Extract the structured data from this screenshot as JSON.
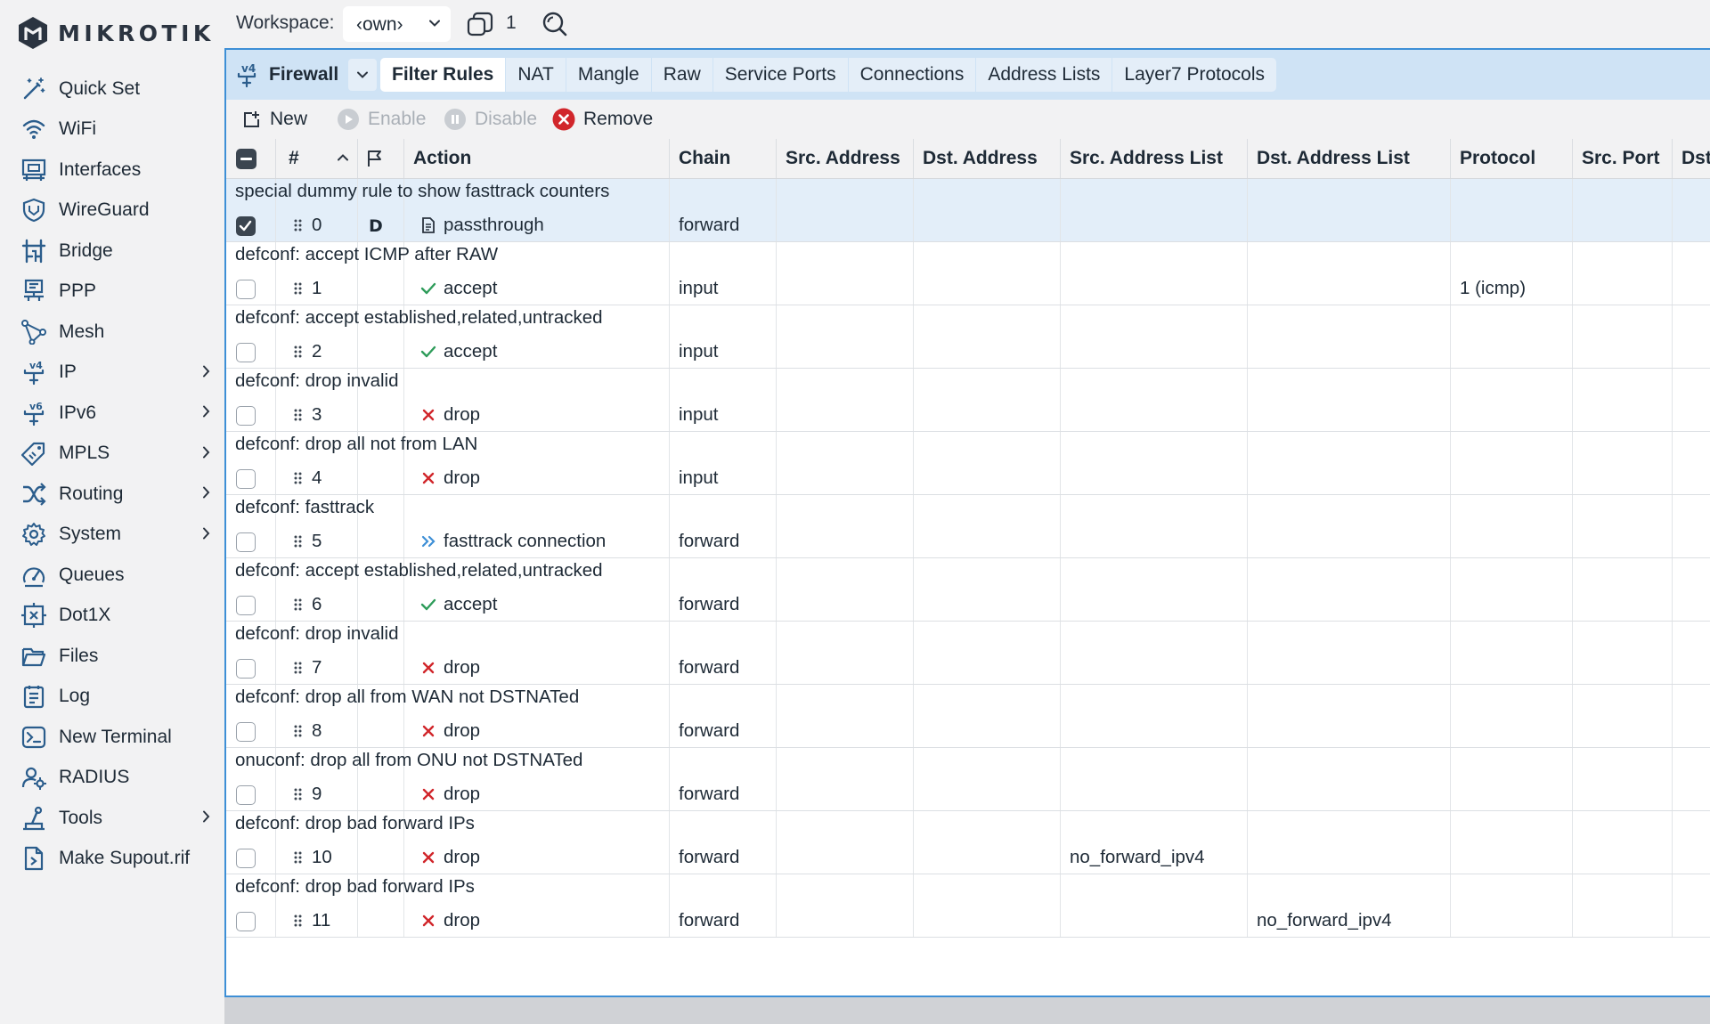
{
  "brand": {
    "name": "MIKROTIK"
  },
  "sidebar": {
    "items": [
      {
        "label": "Quick Set",
        "icon": "wand-icon",
        "has_submenu": false
      },
      {
        "label": "WiFi",
        "icon": "wifi-icon",
        "has_submenu": false
      },
      {
        "label": "Interfaces",
        "icon": "interfaces-icon",
        "has_submenu": false
      },
      {
        "label": "WireGuard",
        "icon": "shield-icon",
        "has_submenu": false
      },
      {
        "label": "Bridge",
        "icon": "bridge-icon",
        "has_submenu": false
      },
      {
        "label": "PPP",
        "icon": "ppp-icon",
        "has_submenu": false
      },
      {
        "label": "Mesh",
        "icon": "mesh-icon",
        "has_submenu": false
      },
      {
        "label": "IP",
        "icon": "ipv4-icon",
        "has_submenu": true
      },
      {
        "label": "IPv6",
        "icon": "ipv6-icon",
        "has_submenu": true
      },
      {
        "label": "MPLS",
        "icon": "tag-icon",
        "has_submenu": true
      },
      {
        "label": "Routing",
        "icon": "routing-icon",
        "has_submenu": true
      },
      {
        "label": "System",
        "icon": "gear-icon",
        "has_submenu": true
      },
      {
        "label": "Queues",
        "icon": "gauge-icon",
        "has_submenu": false
      },
      {
        "label": "Dot1X",
        "icon": "dot1x-icon",
        "has_submenu": false
      },
      {
        "label": "Files",
        "icon": "folder-icon",
        "has_submenu": false
      },
      {
        "label": "Log",
        "icon": "log-icon",
        "has_submenu": false
      },
      {
        "label": "New Terminal",
        "icon": "terminal-icon",
        "has_submenu": false
      },
      {
        "label": "RADIUS",
        "icon": "radius-icon",
        "has_submenu": false
      },
      {
        "label": "Tools",
        "icon": "tools-icon",
        "has_submenu": true
      },
      {
        "label": "Make Supout.rif",
        "icon": "supout-icon",
        "has_submenu": false
      }
    ]
  },
  "topbar": {
    "workspace_label": "Workspace:",
    "workspace_value": "‹own›",
    "window_count": "1"
  },
  "window": {
    "title": "Firewall",
    "tabs": [
      {
        "label": "Filter Rules",
        "active": true
      },
      {
        "label": "NAT",
        "active": false
      },
      {
        "label": "Mangle",
        "active": false
      },
      {
        "label": "Raw",
        "active": false
      },
      {
        "label": "Service Ports",
        "active": false
      },
      {
        "label": "Connections",
        "active": false
      },
      {
        "label": "Address Lists",
        "active": false
      },
      {
        "label": "Layer7 Protocols",
        "active": false
      }
    ],
    "toolbar": {
      "new_label": "New",
      "enable_label": "Enable",
      "disable_label": "Disable",
      "remove_label": "Remove"
    }
  },
  "table": {
    "columns": [
      "#",
      "Action",
      "Chain",
      "Src. Address",
      "Dst. Address",
      "Src. Address List",
      "Dst. Address List",
      "Protocol",
      "Src. Port",
      "Dst"
    ],
    "rows": [
      {
        "comment": "special dummy rule to show fasttrack counters",
        "num": "0",
        "flag": "D",
        "action": "passthrough",
        "action_icon": "document-icon",
        "chain": "forward",
        "src_addr": "",
        "dst_addr": "",
        "src_list": "",
        "dst_list": "",
        "protocol": "",
        "src_port": "",
        "checked": true
      },
      {
        "comment": "defconf: accept ICMP after RAW",
        "num": "1",
        "flag": "",
        "action": "accept",
        "action_icon": "check-icon",
        "chain": "input",
        "src_addr": "",
        "dst_addr": "",
        "src_list": "",
        "dst_list": "",
        "protocol": "1 (icmp)",
        "src_port": "",
        "checked": false
      },
      {
        "comment": "defconf: accept established,related,untracked",
        "num": "2",
        "flag": "",
        "action": "accept",
        "action_icon": "check-icon",
        "chain": "input",
        "src_addr": "",
        "dst_addr": "",
        "src_list": "",
        "dst_list": "",
        "protocol": "",
        "src_port": "",
        "checked": false
      },
      {
        "comment": "defconf: drop invalid",
        "num": "3",
        "flag": "",
        "action": "drop",
        "action_icon": "x-icon",
        "chain": "input",
        "src_addr": "",
        "dst_addr": "",
        "src_list": "",
        "dst_list": "",
        "protocol": "",
        "src_port": "",
        "checked": false
      },
      {
        "comment": "defconf: drop all not from LAN",
        "num": "4",
        "flag": "",
        "action": "drop",
        "action_icon": "x-icon",
        "chain": "input",
        "src_addr": "",
        "dst_addr": "",
        "src_list": "",
        "dst_list": "",
        "protocol": "",
        "src_port": "",
        "checked": false
      },
      {
        "comment": "defconf: fasttrack",
        "num": "5",
        "flag": "",
        "action": "fasttrack connection",
        "action_icon": "double-chevron-icon",
        "chain": "forward",
        "src_addr": "",
        "dst_addr": "",
        "src_list": "",
        "dst_list": "",
        "protocol": "",
        "src_port": "",
        "checked": false
      },
      {
        "comment": "defconf: accept established,related,untracked",
        "num": "6",
        "flag": "",
        "action": "accept",
        "action_icon": "check-icon",
        "chain": "forward",
        "src_addr": "",
        "dst_addr": "",
        "src_list": "",
        "dst_list": "",
        "protocol": "",
        "src_port": "",
        "checked": false
      },
      {
        "comment": "defconf: drop invalid",
        "num": "7",
        "flag": "",
        "action": "drop",
        "action_icon": "x-icon",
        "chain": "forward",
        "src_addr": "",
        "dst_addr": "",
        "src_list": "",
        "dst_list": "",
        "protocol": "",
        "src_port": "",
        "checked": false
      },
      {
        "comment": "defconf: drop all from WAN not DSTNATed",
        "num": "8",
        "flag": "",
        "action": "drop",
        "action_icon": "x-icon",
        "chain": "forward",
        "src_addr": "",
        "dst_addr": "",
        "src_list": "",
        "dst_list": "",
        "protocol": "",
        "src_port": "",
        "checked": false
      },
      {
        "comment": "onuconf: drop all from ONU not DSTNATed",
        "num": "9",
        "flag": "",
        "action": "drop",
        "action_icon": "x-icon",
        "chain": "forward",
        "src_addr": "",
        "dst_addr": "",
        "src_list": "",
        "dst_list": "",
        "protocol": "",
        "src_port": "",
        "checked": false
      },
      {
        "comment": "defconf: drop bad forward IPs",
        "num": "10",
        "flag": "",
        "action": "drop",
        "action_icon": "x-icon",
        "chain": "forward",
        "src_addr": "",
        "dst_addr": "",
        "src_list": "no_forward_ipv4",
        "dst_list": "",
        "protocol": "",
        "src_port": "",
        "checked": false
      },
      {
        "comment": "defconf: drop bad forward IPs",
        "num": "11",
        "flag": "",
        "action": "drop",
        "action_icon": "x-icon",
        "chain": "forward",
        "src_addr": "",
        "dst_addr": "",
        "src_list": "",
        "dst_list": "no_forward_ipv4",
        "protocol": "",
        "src_port": "",
        "checked": false
      }
    ]
  },
  "colors": {
    "accent": "#3e8fd6",
    "tab_bar": "#cfe3f5",
    "accept": "#2e9c5a",
    "drop": "#d1262b",
    "fasttrack": "#3e8fd6",
    "remove": "#d1262b"
  }
}
